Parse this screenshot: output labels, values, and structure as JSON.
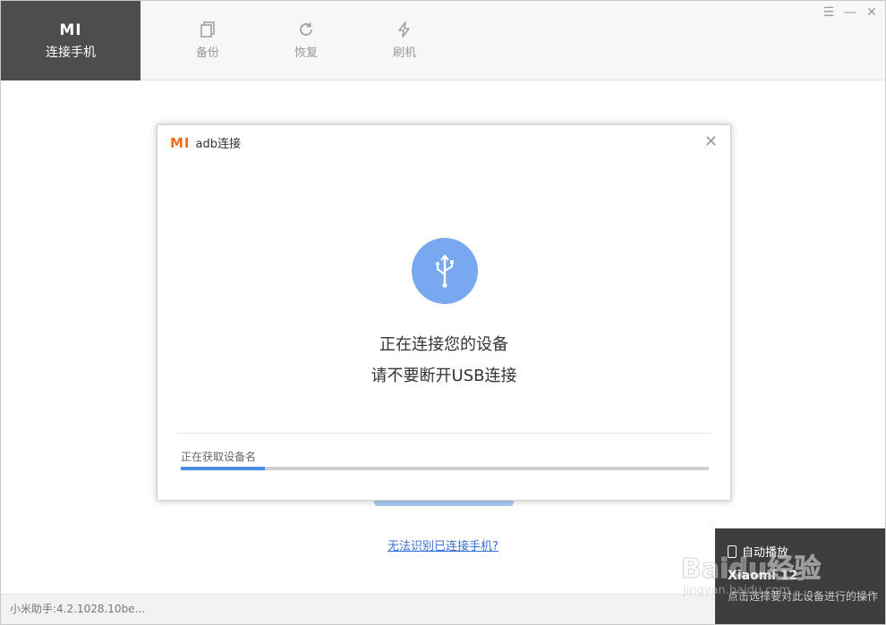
{
  "nav": {
    "active_logo": "MI",
    "connect_label": "连接手机",
    "backup_label": "备份",
    "restore_label": "恢复",
    "flash_label": "刷机"
  },
  "background": {
    "help_link": "无法识别已连接手机?"
  },
  "status": {
    "version": "小米助手:4.2.1028.10be..."
  },
  "modal": {
    "title": "adb连接",
    "mi_logo": "MI",
    "message_line1": "正在连接您的设备",
    "message_line2": "请不要断开USB连接",
    "progress_label": "正在获取设备名",
    "progress_fraction": 0.16
  },
  "toast": {
    "line1": "自动播放",
    "device": "Xiaomi 12",
    "line3": "点击选择要对此设备进行的操作"
  },
  "watermark": {
    "text": "Baidu经验",
    "sub": "jingyan.baidu.com"
  },
  "colors": {
    "nav_active_bg": "#4d4d4d",
    "accent_blue": "#78a8ef",
    "progress_blue": "#4a8ee8",
    "mi_orange": "#ef6c1b"
  }
}
